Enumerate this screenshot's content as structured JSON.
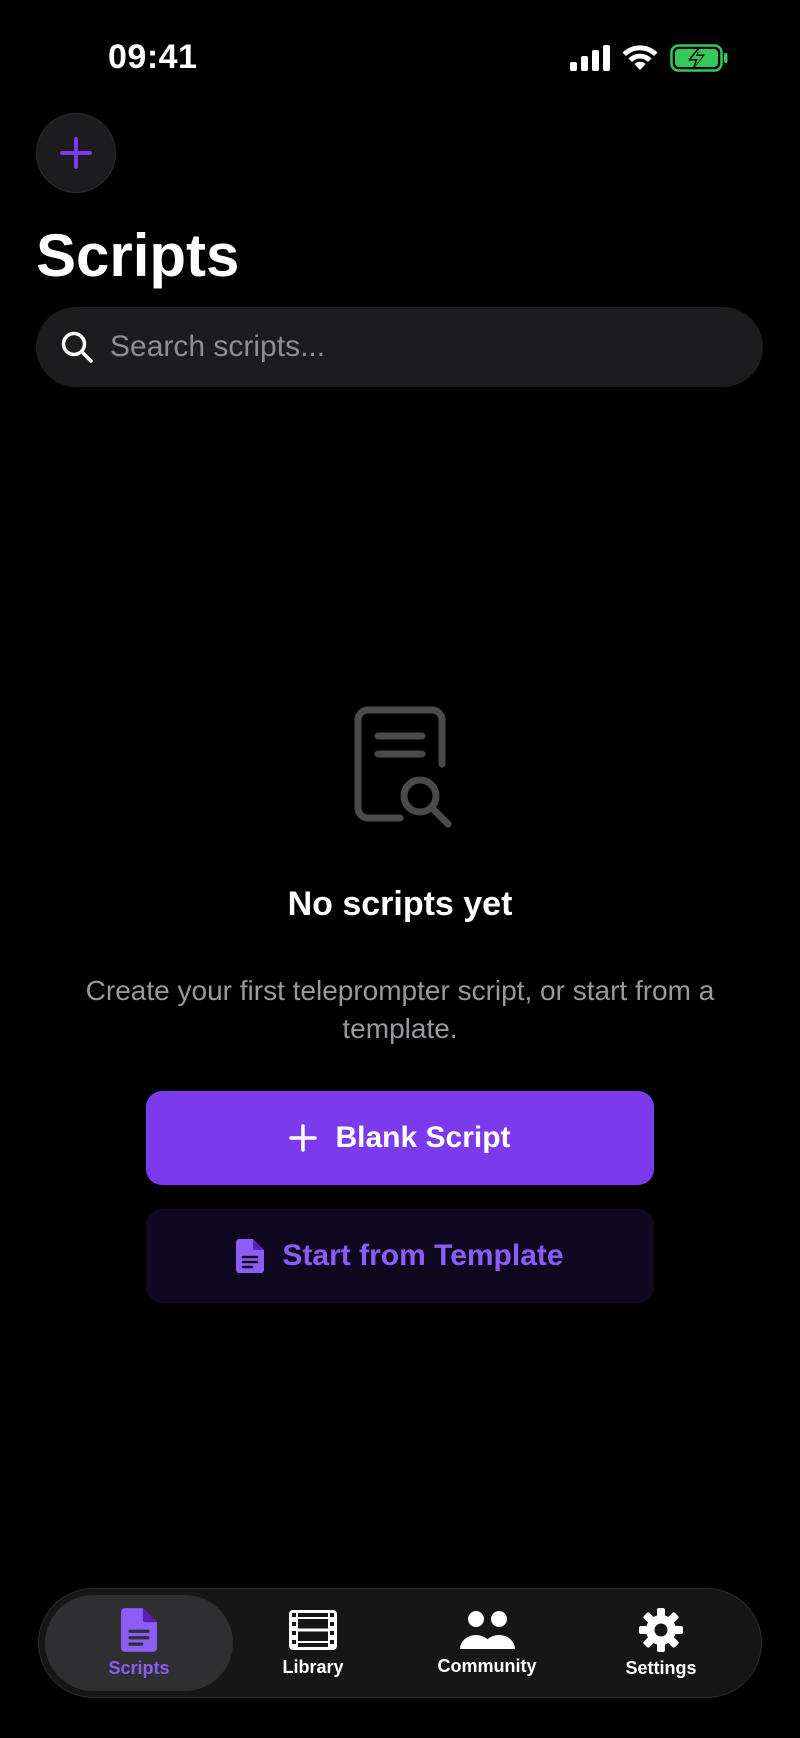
{
  "status_bar": {
    "time": "09:41",
    "icons": [
      "cellular-signal-icon",
      "wifi-icon",
      "battery-charging-icon"
    ]
  },
  "header": {
    "add_icon": "plus-icon",
    "title": "Scripts"
  },
  "search": {
    "icon": "search-icon",
    "placeholder": "Search scripts...",
    "value": ""
  },
  "empty_state": {
    "icon": "document-search-icon",
    "title": "No scripts yet",
    "description": "Create your first teleprompter script, or start from a template.",
    "primary_button": {
      "icon": "plus-icon",
      "label": "Blank Script"
    },
    "secondary_button": {
      "icon": "document-icon",
      "label": "Start from Template"
    }
  },
  "tab_bar": {
    "tabs": [
      {
        "label": "Scripts",
        "icon": "document-icon",
        "active": true
      },
      {
        "label": "Library",
        "icon": "film-icon",
        "active": false
      },
      {
        "label": "Community",
        "icon": "people-icon",
        "active": false
      },
      {
        "label": "Settings",
        "icon": "gear-icon",
        "active": false
      }
    ]
  },
  "colors": {
    "accent": "#7c3aed",
    "accent_text": "#8b5cf6",
    "background": "#000000",
    "surface": "#1c1c1e",
    "battery": "#34c759"
  }
}
